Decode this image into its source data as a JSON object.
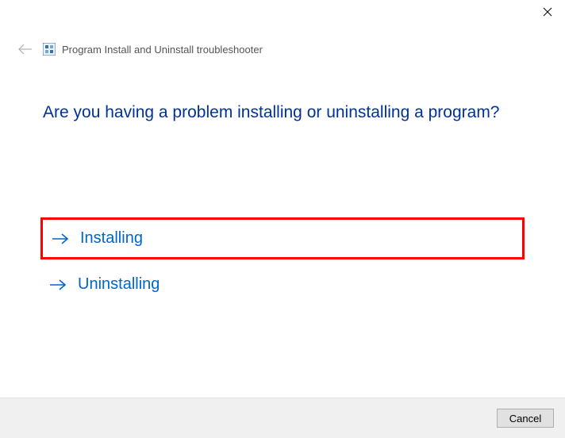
{
  "header": {
    "title": "Program Install and Uninstall troubleshooter"
  },
  "main": {
    "question": "Are you having a problem installing or uninstalling a program?",
    "options": [
      {
        "label": "Installing",
        "highlighted": true
      },
      {
        "label": "Uninstalling",
        "highlighted": false
      }
    ]
  },
  "footer": {
    "cancel_label": "Cancel"
  }
}
